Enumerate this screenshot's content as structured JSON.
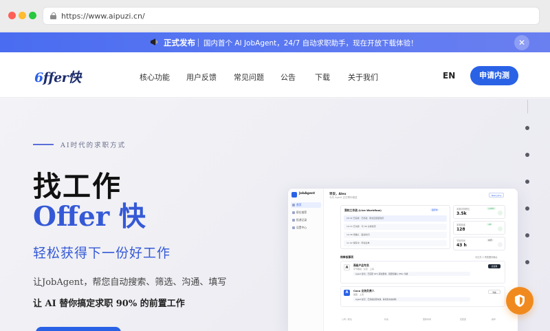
{
  "browser": {
    "url": "https://www.aipuzi.cn/"
  },
  "banner": {
    "tag": "正式发布",
    "message": "国内首个 AI JobAgent，24/7 自动求职助手，现在开放下载体验！",
    "icons": {
      "announce": "megaphone-icon",
      "close": "close-icon"
    },
    "close_glyph": "✕"
  },
  "nav": {
    "logo_o": "6",
    "logo_rest": "ffer快",
    "items": [
      "核心功能",
      "用户反馈",
      "常见问题",
      "公告",
      "下载",
      "关于我们"
    ],
    "lang": "EN",
    "apply": "申请内测"
  },
  "hero": {
    "eyebrow": "AI时代的求职方式",
    "title_line1": "找工作",
    "title_line2": "Offer 快",
    "subtitle": "轻松获得下一份好工作",
    "desc1": "让JobAgent，帮您自动搜索、筛选、沟通、填写",
    "desc2": "让 AI 替你搞定求职 90% 的前置工作"
  },
  "mockup": {
    "brand": "JobAgent",
    "greeting": "早安，Alex",
    "greeting_sub": "今天 Agent 正在帮你推进",
    "top_button": "New Job ▸",
    "sidebar": [
      "首页",
      "职位推荐",
      "投递记录",
      "设置中心"
    ],
    "workflow_title": "我的工作流 (Live Workflow)",
    "workflow_badge": "运行中",
    "workflow_rows": [
      "09:42 已完成 · 已筛选 · 职位匹配度较高",
      "10:15 已沟通 · 与 HR 交换简历",
      "10:38 待确认 · 面试时间",
      "11:02 填写中 · 申请表单"
    ],
    "stats": [
      {
        "label": "本周浏览职位",
        "value": "3.5k",
        "badge": "+12%"
      },
      {
        "label": "本周投递",
        "value": "128",
        "badge": "+8"
      },
      {
        "label": "节省时间",
        "value": "43 h",
        "badge": "本周"
      }
    ],
    "section_title": "待审核事项",
    "section_right": "今日共 2 项需要你确认",
    "tasks": [
      {
        "avatar": "A",
        "name": "高级产品专员",
        "sub": "字节跳动 · 北京 · 上海",
        "note": "Agent 建议：已匹配 92% 职位要求，需要您确认 Offer 沟通",
        "action": "去处理"
      },
      {
        "avatar": "A",
        "name": "Coco 业务负责人",
        "sub": "美团 · 上海",
        "note": "Agent 提示：已完成初筛沟通，等待您补充材料",
        "action": "查看"
      }
    ],
    "table_headers": [
      "公司 / 职位",
      "状态",
      "更新时间",
      "匹配度",
      "操作"
    ],
    "colors": {
      "accent": "#2a62e6",
      "success": "#22a55b",
      "warn": "#f08a1e"
    }
  },
  "float_button": {
    "icon": "shield-icon",
    "color": "#f08a1e"
  }
}
